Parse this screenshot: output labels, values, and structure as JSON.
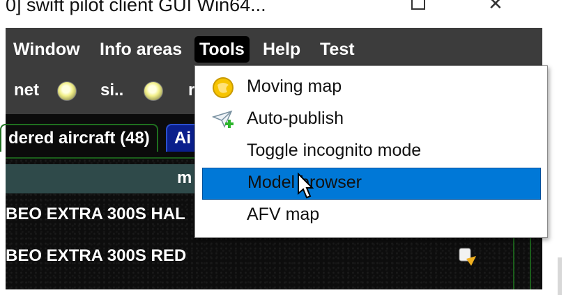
{
  "window": {
    "title": "0] swift pilot client GUI Win64...",
    "controls": {
      "maximize": "□",
      "close": "✕"
    }
  },
  "menubar": {
    "items": [
      {
        "label": "Window"
      },
      {
        "label": "Info areas"
      },
      {
        "label": "Tools",
        "active": true
      },
      {
        "label": "Help"
      },
      {
        "label": "Test"
      }
    ]
  },
  "status": {
    "items": [
      {
        "label": "net"
      },
      {
        "label": "si.."
      },
      {
        "label": "r"
      }
    ]
  },
  "tabs": [
    {
      "label": "dered aircraft (48)"
    },
    {
      "label": "Ai",
      "selected": true
    }
  ],
  "table": {
    "header": "m",
    "rows": [
      "BEO EXTRA 300S HAL",
      "BEO EXTRA 300S RED"
    ]
  },
  "tools_menu": {
    "items": [
      {
        "label": "Moving map",
        "icon": "globe-icon"
      },
      {
        "label": "Auto-publish",
        "icon": "paper-plane-add-icon"
      },
      {
        "label": "Toggle incognito mode",
        "icon": ""
      },
      {
        "label": "Model browser",
        "icon": "",
        "highlighted": true
      },
      {
        "label": "AFV map",
        "icon": ""
      }
    ]
  },
  "colors": {
    "menu_highlight": "#0078d7",
    "tab_selected": "#0a1f8c",
    "tab_border": "#1f6f1f",
    "led": "#f2f08a"
  }
}
